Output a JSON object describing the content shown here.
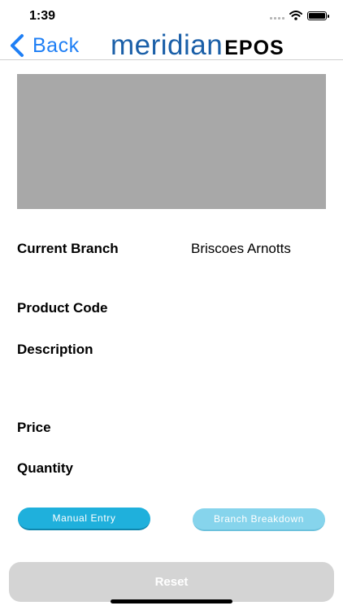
{
  "status_bar": {
    "time": "1:39"
  },
  "nav": {
    "back_label": "Back",
    "logo_main": "meridian",
    "logo_sub": "EPOS"
  },
  "fields": {
    "current_branch_label": "Current Branch",
    "current_branch_value": "Briscoes Arnotts",
    "product_code_label": "Product Code",
    "description_label": "Description",
    "price_label": "Price",
    "quantity_label": "Quantity"
  },
  "buttons": {
    "manual_entry": "Manual Entry",
    "branch_breakdown": "Branch Breakdown",
    "reset": "Reset"
  },
  "colors": {
    "accent_blue": "#1f7ff5",
    "logo_blue": "#1a5fa8",
    "button_cyan": "#1fb0dc",
    "button_cyan_disabled": "#86d4ec",
    "reset_gray": "#d4d4d4"
  }
}
